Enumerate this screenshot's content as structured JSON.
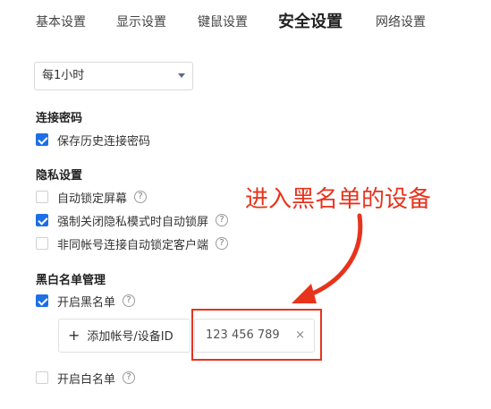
{
  "tabs": [
    {
      "label": "基本设置",
      "active": false
    },
    {
      "label": "显示设置",
      "active": false
    },
    {
      "label": "键鼠设置",
      "active": false
    },
    {
      "label": "安全设置",
      "active": true
    },
    {
      "label": "网络设置",
      "active": false
    }
  ],
  "lock_interval": {
    "selected": "每1小时"
  },
  "connection_password": {
    "title": "连接密码",
    "save_history": {
      "label": "保存历史连接密码",
      "checked": true
    }
  },
  "privacy": {
    "title": "隐私设置",
    "items": [
      {
        "label": "自动锁定屏幕",
        "checked": false,
        "help": "?"
      },
      {
        "label": "强制关闭隐私模式时自动锁屏",
        "checked": true,
        "help": "?"
      },
      {
        "label": "非同帐号连接自动锁定客户端",
        "checked": false,
        "help": "?"
      }
    ]
  },
  "blacklist_whitelist": {
    "title": "黑白名单管理",
    "blacklist": {
      "label": "开启黑名单",
      "checked": true,
      "help": "?"
    },
    "add_button_label": "添加帐号/设备ID",
    "entries": [
      {
        "id": "123 456 789",
        "remove": "×"
      }
    ],
    "whitelist": {
      "label": "开启白名单",
      "checked": false,
      "help": "?"
    }
  },
  "annotation": {
    "text": "进入黑名单的设备",
    "color": "#e8331c"
  },
  "colors": {
    "accent": "#1c6fe6",
    "annotation": "#e8331c"
  }
}
